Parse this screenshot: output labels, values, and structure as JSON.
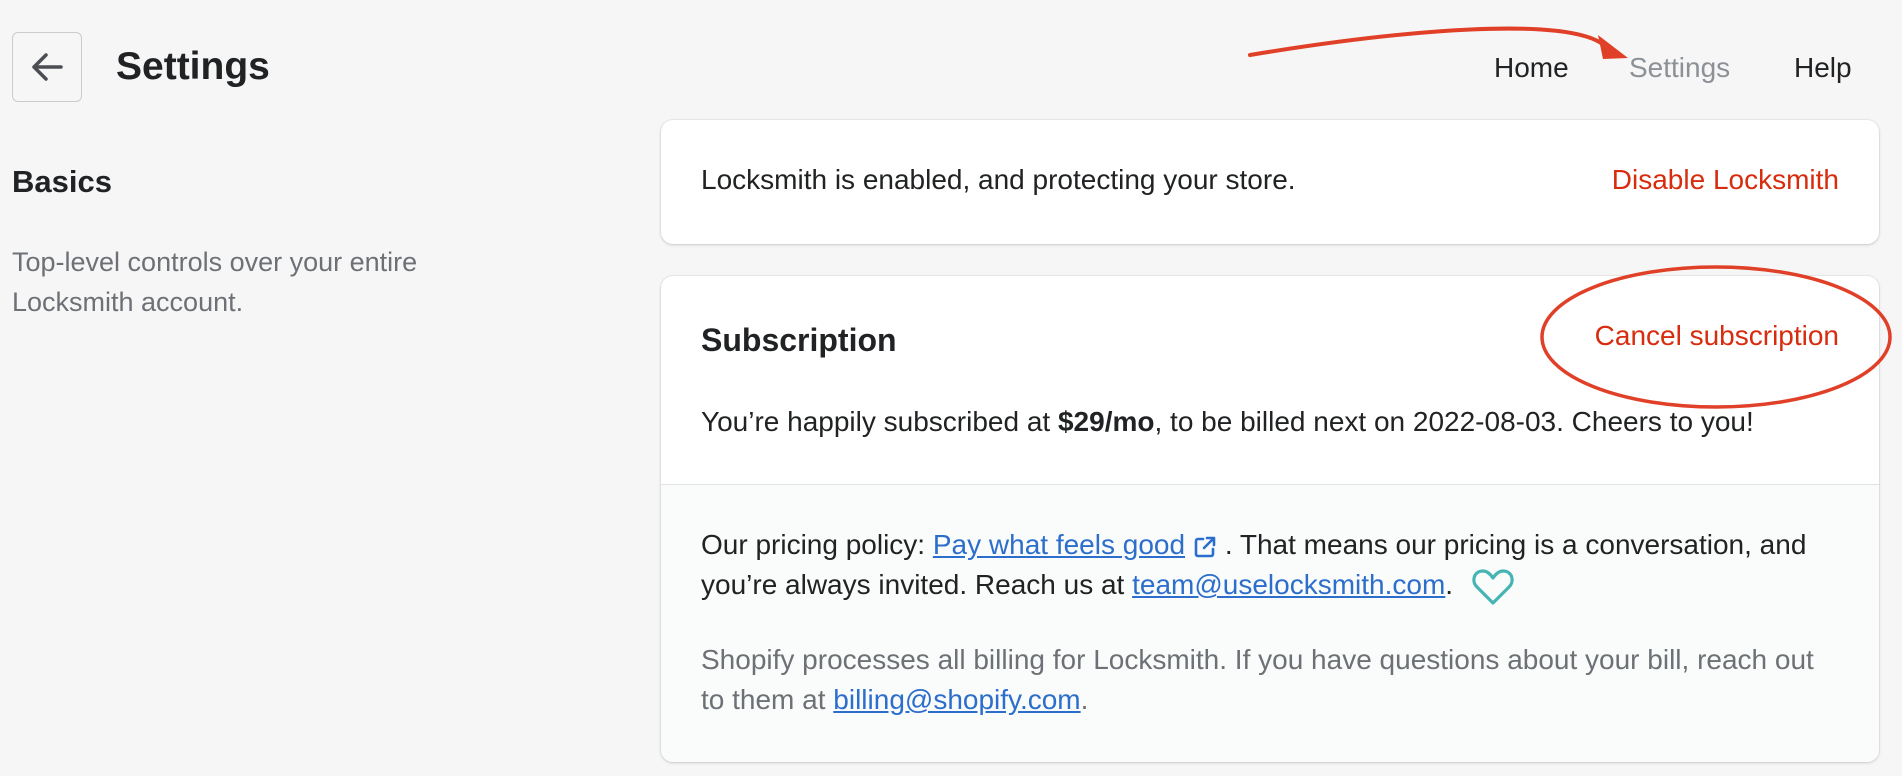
{
  "header": {
    "back_label": "Back",
    "title": "Settings",
    "nav": {
      "home": "Home",
      "settings": "Settings",
      "help": "Help"
    }
  },
  "section": {
    "title": "Basics",
    "description": "Top-level controls over your entire Locksmith account."
  },
  "status_card": {
    "text": "Locksmith is enabled, and protecting your store.",
    "action": "Disable Locksmith"
  },
  "subscription_card": {
    "title": "Subscription",
    "action": "Cancel subscription",
    "text_before": "You’re happily subscribed at ",
    "price": "$29/mo",
    "text_after": ", to be billed next on 2022-08-03. Cheers to you!",
    "policy_prefix": "Our pricing policy: ",
    "policy_link": "Pay what feels good",
    "policy_middle": " . That means our pricing is a conversation, and you’re always invited. Reach us at ",
    "policy_email": "team@uselocksmith.com",
    "policy_end": ".",
    "billing_prefix": "Shopify processes all billing for Locksmith. If you have questions about your bill, reach out to them at ",
    "billing_email": "billing@shopify.com",
    "billing_end": "."
  },
  "colors": {
    "accent_red": "#d72c0d",
    "link_blue": "#2c6ecb",
    "annotation_red": "#e04028",
    "heart_teal": "#47b4b4"
  },
  "icons": [
    "arrow-left-icon",
    "external-link-icon",
    "heart-icon"
  ]
}
